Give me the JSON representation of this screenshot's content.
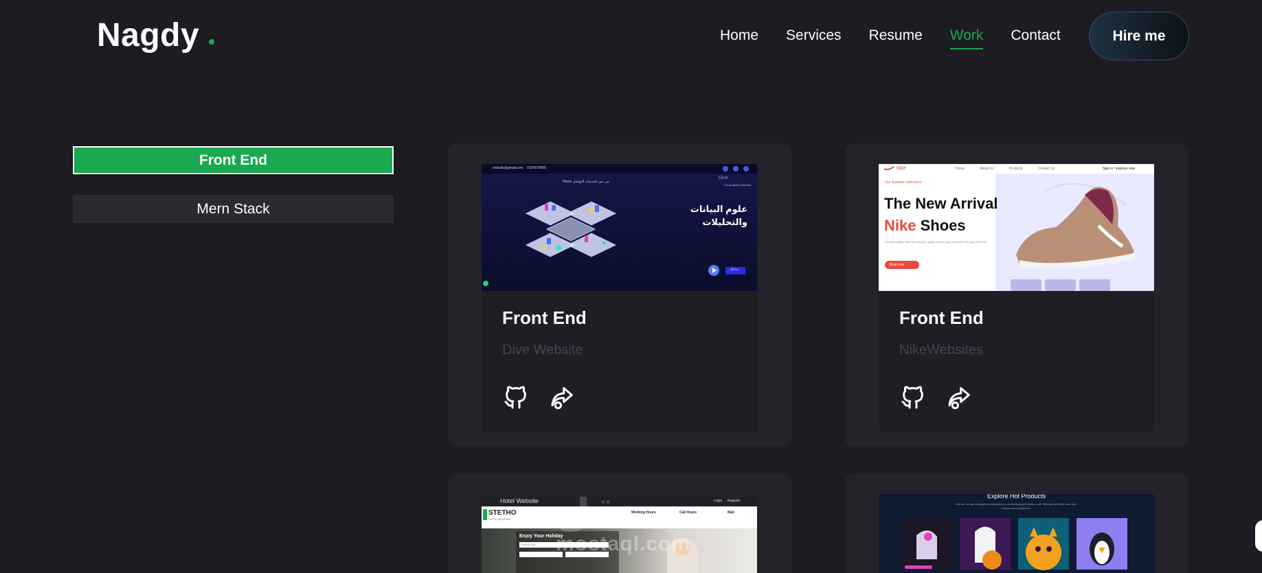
{
  "header": {
    "logo": "Nagdy",
    "nav": [
      {
        "label": "Home",
        "active": false
      },
      {
        "label": "Services",
        "active": false
      },
      {
        "label": "Resume",
        "active": false
      },
      {
        "label": "Work",
        "active": true
      },
      {
        "label": "Contact",
        "active": false
      }
    ],
    "hire_label": "Hire me"
  },
  "filters": {
    "active": "Front End",
    "other": "Mern Stack"
  },
  "projects": [
    {
      "category": "Front End",
      "name": "Dive Website",
      "thumb": {
        "email": "website@gmail.com",
        "phone": "0194570495",
        "nav": "Home  من نحن  الخدمات  التواصل",
        "heading_line1": "علوم البيانات",
        "heading_line2": "والتحليلات",
        "brand": "Dive",
        "tagline": "For Analytics Services",
        "cta": "ابدأ الآن"
      }
    },
    {
      "category": "Front End",
      "name": "NikeWebsites",
      "thumb": {
        "brand": "Nike",
        "nav_items": [
          "Home",
          "About Us",
          "Products",
          "Contact Us"
        ],
        "auth": "Sign in  /  Explore now",
        "eyebrow": "Our Summer collections",
        "heading_line1": "The New Arrival",
        "heading_accent": "Nike",
        "heading_line2": "Shoes",
        "body": "Discover stylish Nike new arrivals, quality comfort, and innovation for your active life.",
        "cta": "Shop now"
      }
    }
  ],
  "lower_thumbs": {
    "hotel_title": "Hotel Website",
    "hotel_brand": "STETHO",
    "hotel_brand_sub": "HOTEL BOOKING",
    "hotel_login": "Login",
    "hotel_register": "Register",
    "hotel_hours": "Working Hours",
    "hotel_call": "Call Hours",
    "hotel_mail": "Mail",
    "hotel_hero": "Enjoy Your Holiday",
    "hotel_search": "Search City",
    "products_title": "Explore Hot Products",
    "products_sub": "We are a huge marketplace dedicated to connecting great artists of all Tethered with their fans and unique token collectors!",
    "watermark": "mostaql.com"
  },
  "colors": {
    "accent": "#1aa850",
    "background": "#1c1c22",
    "card": "#232329",
    "muted": "#3d4556"
  }
}
